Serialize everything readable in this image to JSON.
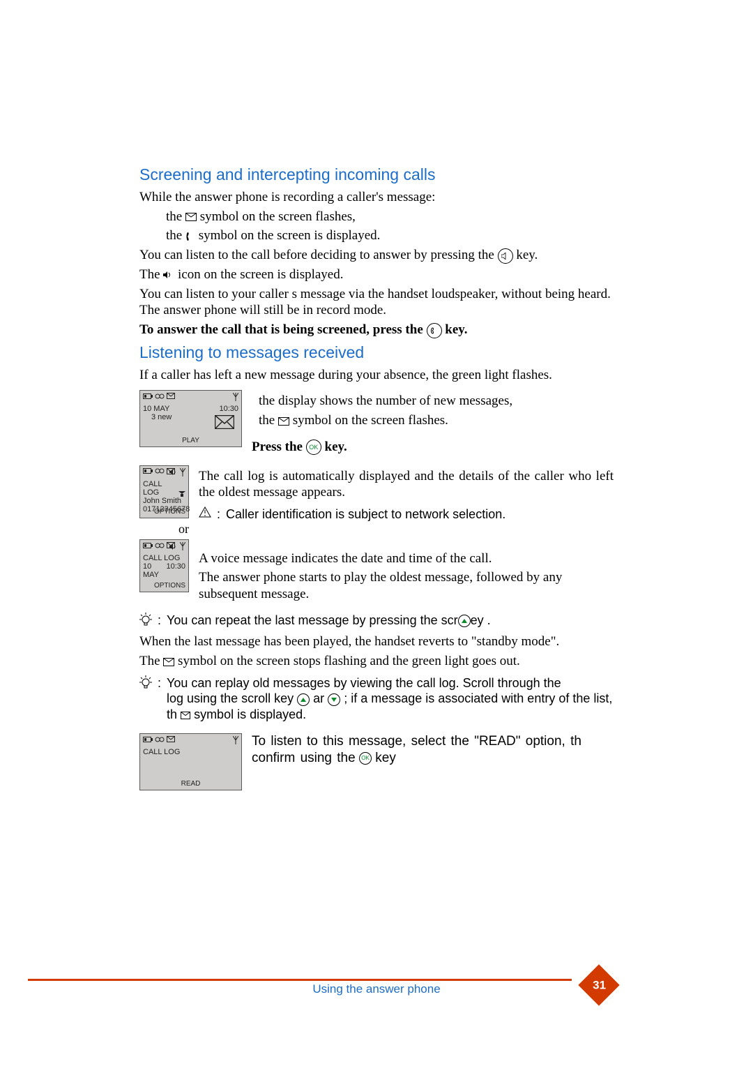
{
  "headings": {
    "h2a": "Screening  and intercepting incoming calls",
    "h2b": "Listening to messages received"
  },
  "screening": {
    "intro": "While the answer phone is recording a caller's message:",
    "bullet1": "the       symbol on the screen flashes,",
    "bullet2": "the       symbol on the screen is displayed.",
    "line3a": "You can listen to the call before deciding to answer by pressing the ",
    "line3b": " key.",
    "line4a": "The ",
    "line4b": " icon on the screen is displayed.",
    "line5": "You can listen to your caller s message via the handset loudspeaker, without being heard. The answer phone will still be in record mode.",
    "line6a": "To answer the call that is being screened, press the ",
    "line6b": " key."
  },
  "listening": {
    "intro": "If a caller has left a new message during your absence, the green light flashes.",
    "r1a": "the display shows the number of new messages,",
    "r1b": "the        symbol on the screen flashes.",
    "press_ok_a": "Press the ",
    "press_ok_b": " key.",
    "r2a": "The call log is automatically displayed and the details of the caller who left the oldest message appears.",
    "warn": "Caller identification is subject to network selection.",
    "or": "or",
    "r3a": "A voice message indicates the date and time of the call.",
    "r3b": "The answer phone starts to play the oldest message, followed by any subsequent message.",
    "tip1a": "You can repeat the last message by pressing the scr",
    "tip1b": "ey       .",
    "after1": "When the last message has been played, the handset reverts to \"standby mode\".",
    "after2": "The        symbol on the screen stops flashing and the green light goes out.",
    "tip2a": "You can replay old messages by viewing the call log. Scroll through  the ",
    "tip2b": "log using the scroll key",
    "tip2c": "    ar",
    "tip2d": "   ; if a message is associated with   entry of the list, th",
    "tip2e": " symbol is displayed.",
    "r4a": "To listen to this message, select the \"READ\" option, th   confirm using the",
    "r4b": "  key"
  },
  "screens": {
    "s1": {
      "date": "10 MAY",
      "time": "10:30",
      "new": "3 new",
      "bottom": "PLAY"
    },
    "s2": {
      "title": "CALL LOG",
      "name": "John Smith",
      "num": "01712345678",
      "br": "OPTIONS"
    },
    "s3": {
      "title": "CALL LOG",
      "date": "10 MAY",
      "time": "10:30",
      "br": "OPTIONS"
    },
    "s4": {
      "title": "CALL LOG",
      "bottom": "READ"
    }
  },
  "footer": {
    "text": "Using the answer phone",
    "page": "31"
  }
}
